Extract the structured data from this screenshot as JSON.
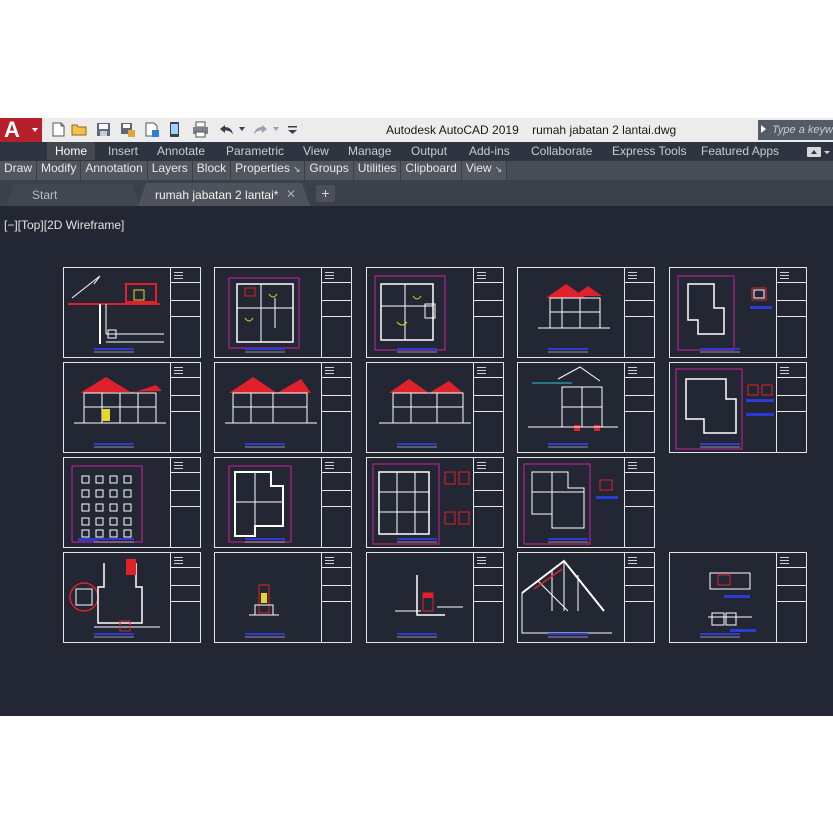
{
  "app": {
    "logo_letter": "A",
    "window_title": "Autodesk AutoCAD 2019    rumah jabatan 2 lantai.dwg",
    "search_placeholder": "Type a keyword or phrase"
  },
  "quick_access": [
    "new-icon",
    "open-icon",
    "save-icon",
    "save-as-icon",
    "open-from-web-icon",
    "save-to-web-icon",
    "plot-icon",
    "undo-icon",
    "redo-icon",
    "customize-icon"
  ],
  "ribbon_tabs": [
    "Home",
    "Insert",
    "Annotate",
    "Parametric",
    "View",
    "Manage",
    "Output",
    "Add-ins",
    "Collaborate",
    "Express Tools",
    "Featured Apps"
  ],
  "panels": [
    {
      "label": "Draw"
    },
    {
      "label": "Modify"
    },
    {
      "label": "Annotation"
    },
    {
      "label": "Layers"
    },
    {
      "label": "Block"
    },
    {
      "label": "Properties",
      "arrow": "↘"
    },
    {
      "label": "Groups"
    },
    {
      "label": "Utilities"
    },
    {
      "label": "Clipboard"
    },
    {
      "label": "View",
      "arrow": "↘"
    }
  ],
  "doc_tabs": {
    "start": "Start",
    "active": "rumah jabatan 2 lantai*",
    "close": "✕",
    "new_tab": "+"
  },
  "viewport": {
    "controls": "[−][Top][2D Wireframe]"
  },
  "colors": {
    "canvas": "#222733",
    "sheet_border": "#e6e6e6",
    "drawing_white": "#ffffff",
    "drawing_red": "#e0202a",
    "drawing_magenta": "#d0209e",
    "drawing_yellow": "#e8d52a",
    "drawing_blue": "#2a3bd6",
    "drawing_cyan": "#28c8d8"
  },
  "sheets": [
    {
      "row": 0,
      "col": 0,
      "content": "site-plan"
    },
    {
      "row": 0,
      "col": 1,
      "content": "floor-plan-ground"
    },
    {
      "row": 0,
      "col": 2,
      "content": "floor-plan-upper"
    },
    {
      "row": 0,
      "col": 3,
      "content": "front-elevation"
    },
    {
      "row": 0,
      "col": 4,
      "content": "detail-plan"
    },
    {
      "row": 1,
      "col": 0,
      "content": "elevation-left"
    },
    {
      "row": 1,
      "col": 1,
      "content": "elevation-right"
    },
    {
      "row": 1,
      "col": 2,
      "content": "elevation-rear"
    },
    {
      "row": 1,
      "col": 3,
      "content": "section"
    },
    {
      "row": 1,
      "col": 4,
      "content": "detail-plan-2"
    },
    {
      "row": 2,
      "col": 0,
      "content": "foundation-plan"
    },
    {
      "row": 2,
      "col": 1,
      "content": "slab-plan"
    },
    {
      "row": 2,
      "col": 2,
      "content": "beam-plan"
    },
    {
      "row": 2,
      "col": 3,
      "content": "roof-plan"
    },
    {
      "row": 3,
      "col": 0,
      "content": "footing-detail"
    },
    {
      "row": 3,
      "col": 1,
      "content": "column-detail"
    },
    {
      "row": 3,
      "col": 2,
      "content": "wall-detail"
    },
    {
      "row": 3,
      "col": 3,
      "content": "truss-detail"
    },
    {
      "row": 3,
      "col": 4,
      "content": "misc-detail"
    }
  ]
}
